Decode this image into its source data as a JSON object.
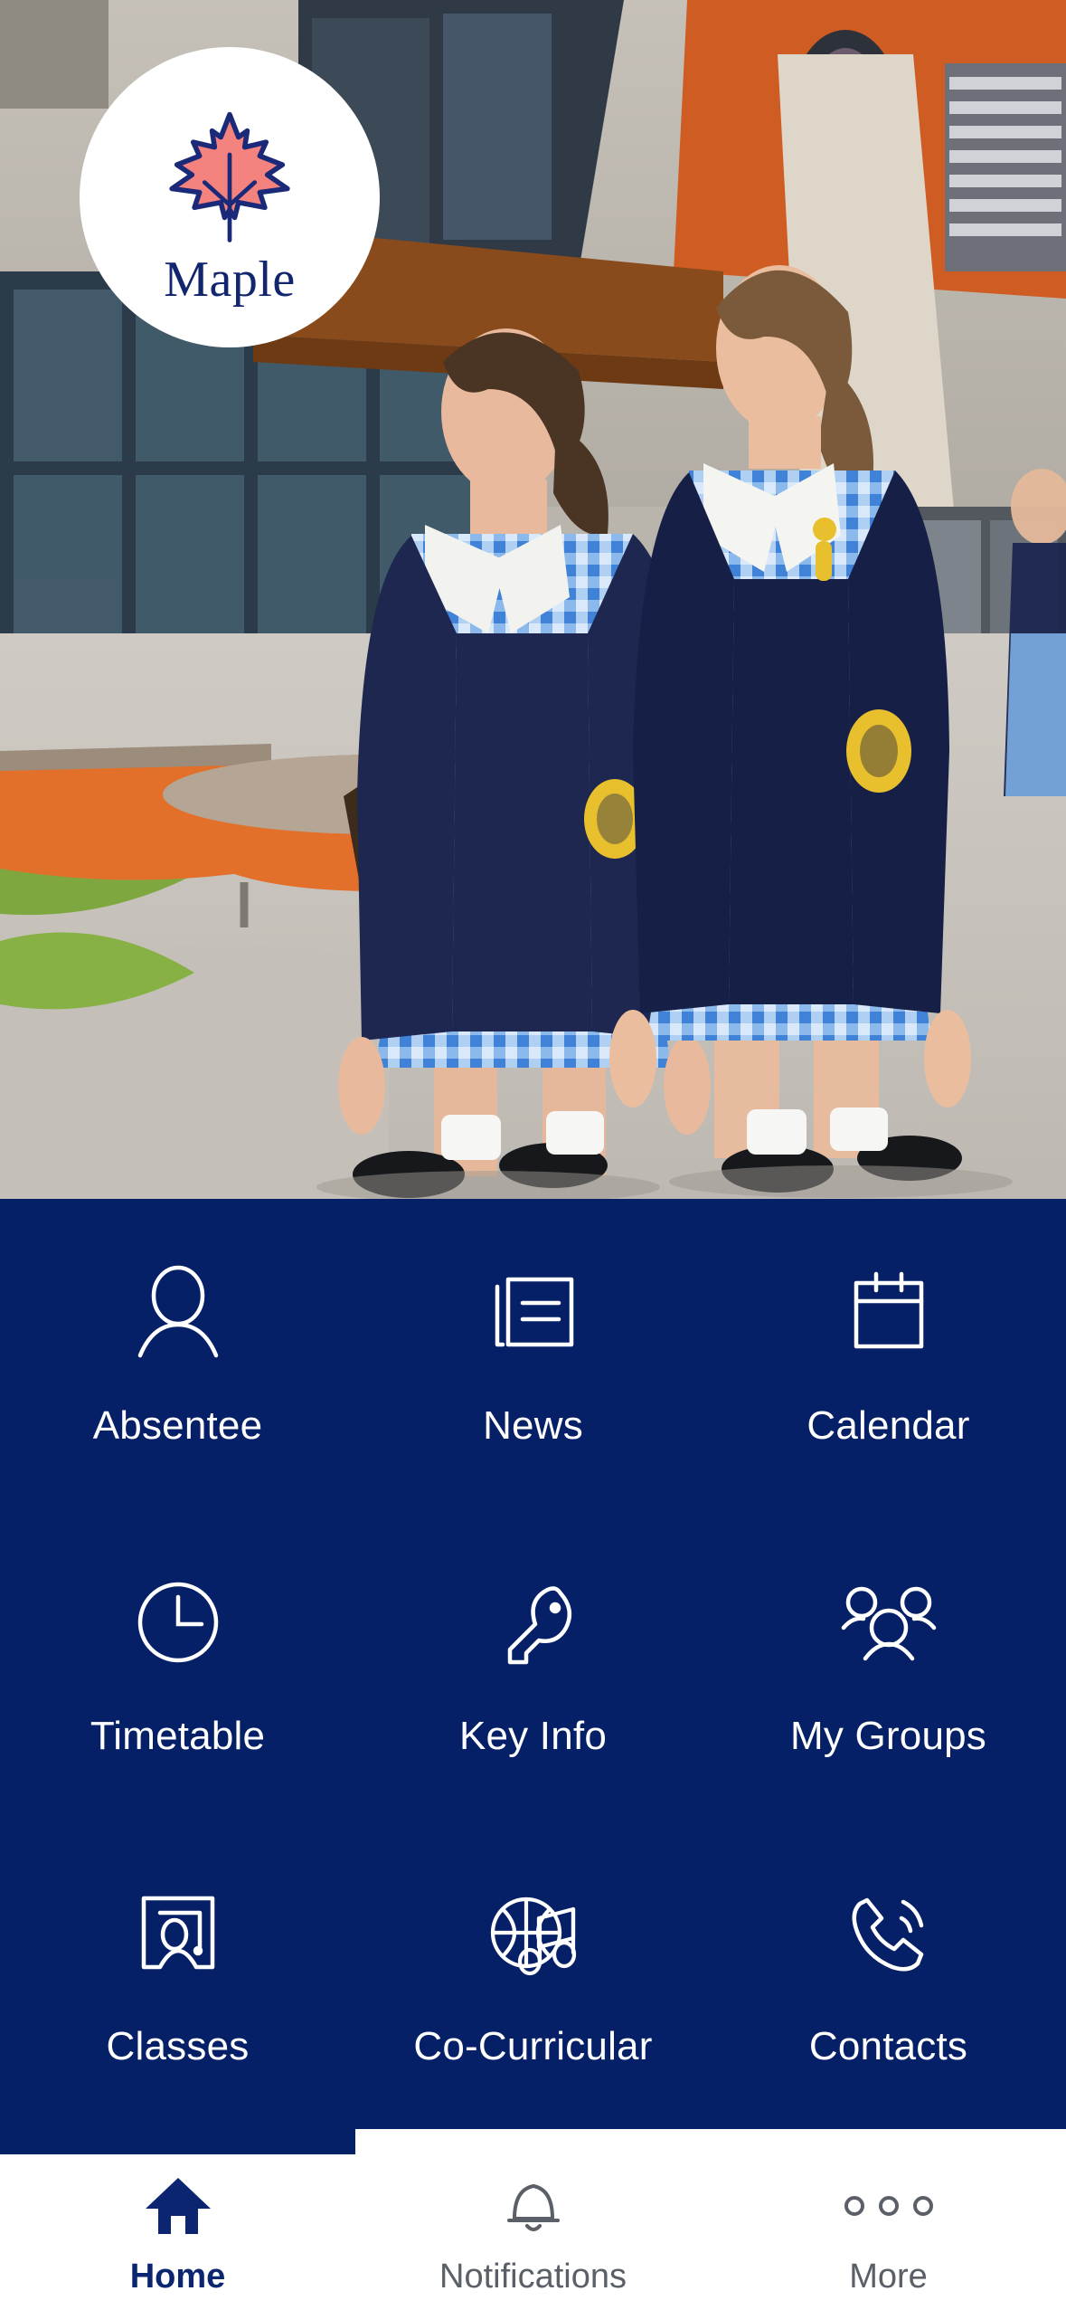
{
  "brand": {
    "name": "Maple",
    "logo_icon": "maple-leaf-icon",
    "leaf_fill": "#F4837F",
    "leaf_stroke": "#1B2A78",
    "navy": "#062068",
    "badge_background": "#FFFFFF"
  },
  "hero": {
    "alt": "Two students in navy blazers and blue gingham dresses walking outside a school building",
    "colors": {
      "sky_wall": "#BFBAB1",
      "orange_accent": "#D7621F",
      "blazer_navy": "#1B2550",
      "gingham_blue": "#4A8FE0",
      "pavement": "#C9C5BE",
      "grass": "#7FA83F"
    }
  },
  "menu": {
    "items": [
      {
        "label": "Absentee",
        "icon": "person-icon"
      },
      {
        "label": "News",
        "icon": "newspaper-icon"
      },
      {
        "label": "Calendar",
        "icon": "calendar-icon"
      },
      {
        "label": "Timetable",
        "icon": "clock-icon"
      },
      {
        "label": "Key Info",
        "icon": "key-icon"
      },
      {
        "label": "My Groups",
        "icon": "people-group-icon"
      },
      {
        "label": "Classes",
        "icon": "classroom-board-icon"
      },
      {
        "label": "Co-Curricular",
        "icon": "basketball-music-icon"
      },
      {
        "label": "Contacts",
        "icon": "phone-icon"
      }
    ]
  },
  "tabbar": {
    "active": "Home",
    "tabs": [
      {
        "label": "Home",
        "icon": "home-icon",
        "active": true
      },
      {
        "label": "Notifications",
        "icon": "bell-icon",
        "active": false
      },
      {
        "label": "More",
        "icon": "three-dots-icon",
        "active": false
      }
    ]
  }
}
